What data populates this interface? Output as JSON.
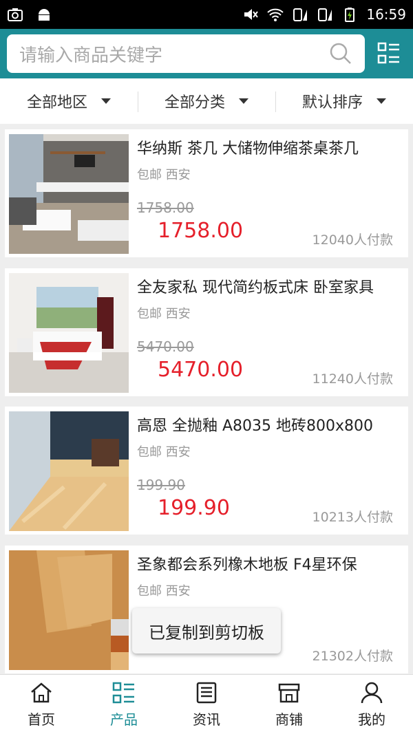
{
  "status_bar": {
    "time": "16:59"
  },
  "search": {
    "placeholder": "请输入商品关键字"
  },
  "filters": [
    {
      "label": "全部地区"
    },
    {
      "label": "全部分类"
    },
    {
      "label": "默认排序"
    }
  ],
  "products": [
    {
      "title": "华纳斯 茶几 大储物伸缩茶桌茶几",
      "tags": "包邮 西安",
      "old_price": "1758.00",
      "price": "1758.00",
      "sold": "12040人付款"
    },
    {
      "title": "全友家私 现代简约板式床 卧室家具",
      "tags": "包邮 西安",
      "old_price": "5470.00",
      "price": "5470.00",
      "sold": "11240人付款"
    },
    {
      "title": "高恩 全抛釉 A8035 地砖800x800",
      "tags": "包邮 西安",
      "old_price": "199.90",
      "price": "199.90",
      "sold": "10213人付款"
    },
    {
      "title": "圣象都会系列橡木地板 F4星环保",
      "tags": "包邮 西安",
      "old_price": "",
      "price": "",
      "sold": "21302人付款"
    }
  ],
  "toast": {
    "text": "已复制到剪切板"
  },
  "nav": [
    {
      "label": "首页",
      "icon": "home-icon"
    },
    {
      "label": "产品",
      "icon": "product-list-icon"
    },
    {
      "label": "资讯",
      "icon": "news-icon"
    },
    {
      "label": "商铺",
      "icon": "shop-icon"
    },
    {
      "label": "我的",
      "icon": "user-icon"
    }
  ],
  "colors": {
    "accent": "#1d8d96",
    "price": "#e5202b"
  }
}
